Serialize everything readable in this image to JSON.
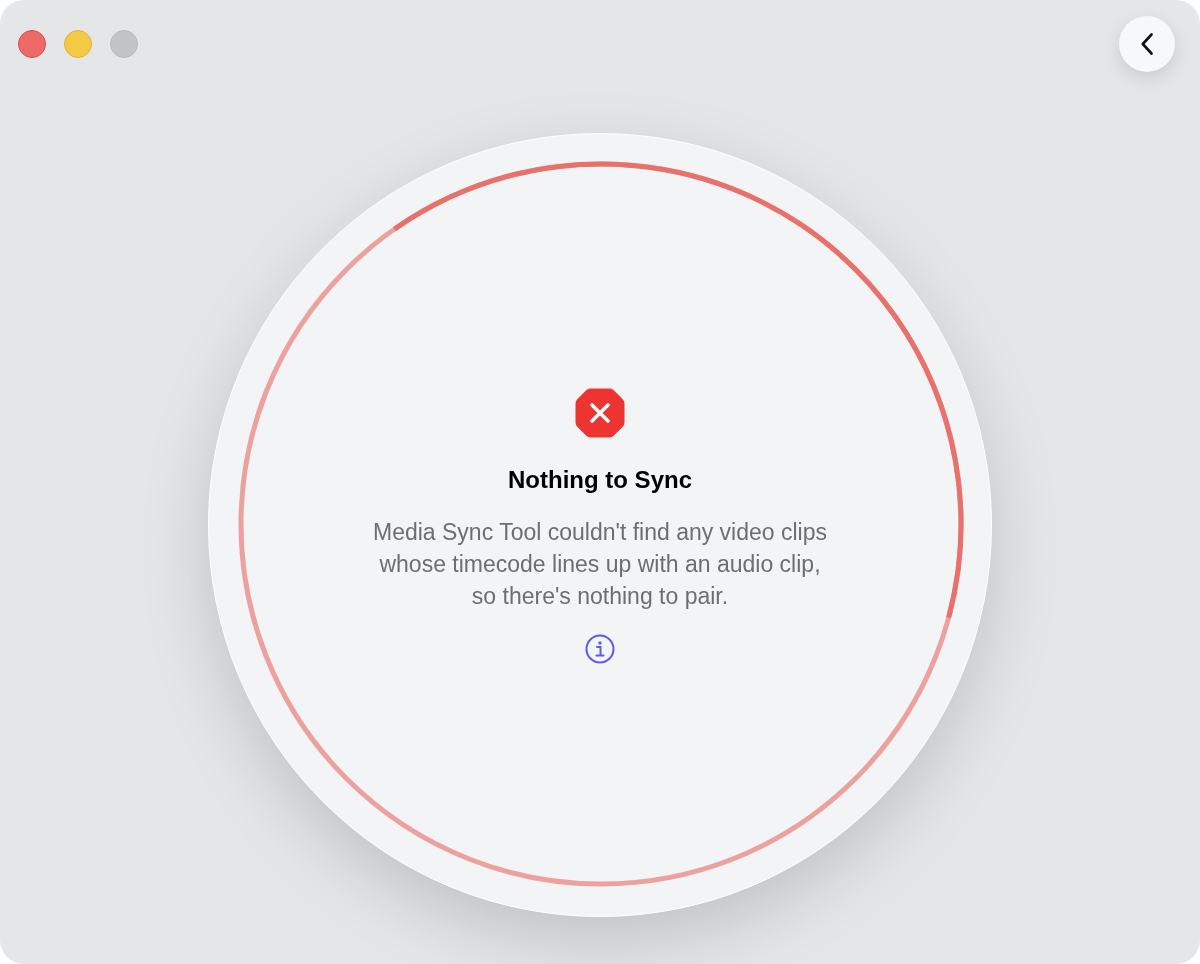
{
  "window": {
    "controls": [
      {
        "kind": "close",
        "disabled": false
      },
      {
        "kind": "minimize",
        "disabled": false
      },
      {
        "kind": "zoom",
        "disabled": true
      }
    ]
  },
  "status": {
    "kind": "error",
    "title": "Nothing to Sync",
    "message": "Media Sync Tool couldn't find any video clips\nwhose timecode lines up with an audio clip,\nso there's nothing to pair."
  }
}
